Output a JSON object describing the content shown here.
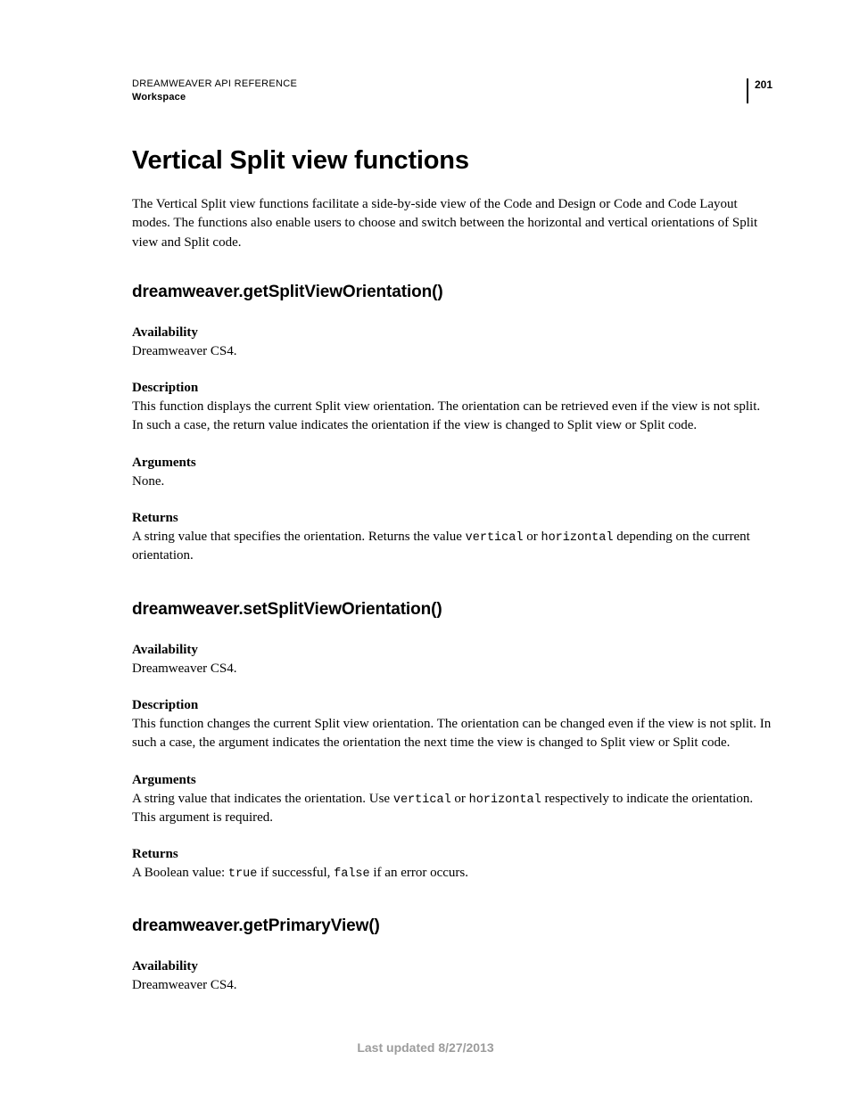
{
  "header": {
    "reference": "DREAMWEAVER API REFERENCE",
    "section": "Workspace",
    "pageNumber": "201"
  },
  "title": "Vertical Split view functions",
  "intro": "The Vertical Split view functions facilitate a side-by-side view of the Code and Design or Code and Code Layout modes. The functions also enable users to choose and switch between the horizontal and vertical orientations of Split view and Split code.",
  "functions": [
    {
      "name": "dreamweaver.getSplitViewOrientation()",
      "availability": {
        "label": "Availability",
        "text": "Dreamweaver CS4."
      },
      "description": {
        "label": "Description",
        "text": "This function displays the current Split view orientation. The orientation can be retrieved even if the view is not split. In such a case, the return value indicates the orientation if the view is changed to Split view or Split code."
      },
      "arguments": {
        "label": "Arguments",
        "text": "None."
      },
      "returns": {
        "label": "Returns",
        "pre": "A string value that specifies the orientation. Returns the value ",
        "code1": "vertical",
        "mid": " or ",
        "code2": "horizontal",
        "post": " depending on the current orientation."
      }
    },
    {
      "name": "dreamweaver.setSplitViewOrientation()",
      "availability": {
        "label": "Availability",
        "text": "Dreamweaver CS4."
      },
      "description": {
        "label": "Description",
        "text": "This function changes the current Split view orientation. The orientation can be changed even if the view is not split. In such a case, the argument indicates the orientation the next time the view is changed to Split view or Split code."
      },
      "arguments": {
        "label": "Arguments",
        "pre": "A string value that indicates the orientation. Use ",
        "code1": "vertical",
        "mid": " or ",
        "code2": "horizontal",
        "post": " respectively to indicate the orientation. This argument is required."
      },
      "returns": {
        "label": "Returns",
        "pre": "A Boolean value: ",
        "code1": "true",
        "mid": " if successful, ",
        "code2": "false",
        "post": " if an error occurs."
      }
    },
    {
      "name": "dreamweaver.getPrimaryView()",
      "availability": {
        "label": "Availability",
        "text": "Dreamweaver CS4."
      }
    }
  ],
  "footer": "Last updated 8/27/2013"
}
